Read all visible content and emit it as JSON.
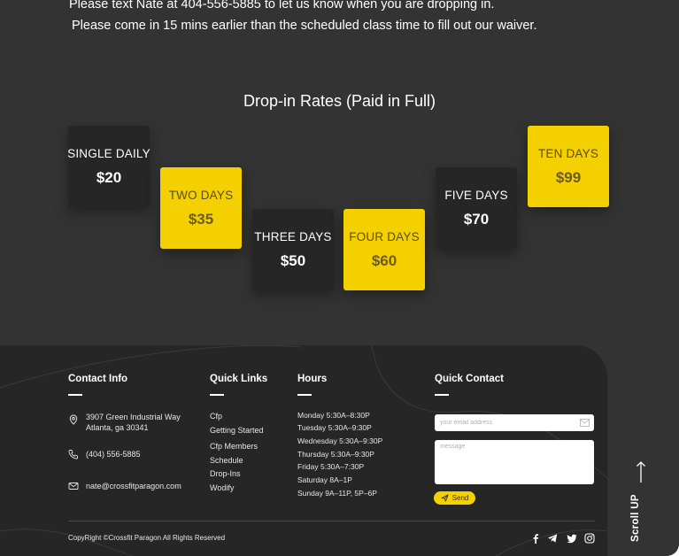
{
  "notice": {
    "line1": "Please text Nate at 404-556-5885 to let us know when you are dropping in.",
    "line2": "Please come in 15 mins earlier than the scheduled class time to fill out our waiver."
  },
  "rates": {
    "title": "Drop-in Rates (Paid in Full)",
    "cards": [
      {
        "name": "SINGLE DAILY",
        "price": "$20",
        "style": "dark"
      },
      {
        "name": "TWO DAYS",
        "price": "$35",
        "style": "yellow"
      },
      {
        "name": "THREE DAYS",
        "price": "$50",
        "style": "dark"
      },
      {
        "name": "FOUR DAYS",
        "price": "$60",
        "style": "yellow"
      },
      {
        "name": "FIVE DAYS",
        "price": "$70",
        "style": "dark"
      },
      {
        "name": "TEN DAYS",
        "price": "$99",
        "style": "yellow"
      }
    ]
  },
  "footer": {
    "contact": {
      "heading": "Contact Info",
      "address_line1": "3907 Green Industrial Way",
      "address_line2": "Atlanta, ga 30341",
      "phone": "(404) 556-5885",
      "email": "nate@crossfitparagon.com"
    },
    "quick_links": {
      "heading": "Quick Links",
      "items": [
        "Cfp",
        "Getting Started",
        "Cfp Members",
        "Schedule",
        "Drop-Ins",
        "Wodify"
      ]
    },
    "hours": {
      "heading": "Hours",
      "items": [
        "Monday  5:30A–8:30P",
        "Tuesday  5:30A–9:30P",
        "Wednesday 5:30A–9:30P",
        "Thursday  5:30A–9:30P",
        "Friday  5:30A–7:30P",
        "Saturday  8A–1P",
        "Sunday  9A–11P, 5P–6P"
      ]
    },
    "quick_contact": {
      "heading": "Quick Contact",
      "email_placeholder": "your email address",
      "message_placeholder": "message",
      "send_label": "Send"
    },
    "copyright": "CopyRight ©Crossfit Paragon  All Rights Reserved",
    "social": [
      "facebook-icon",
      "telegram-icon",
      "twitter-icon",
      "instagram-icon"
    ]
  },
  "scroll_up": {
    "label": "Scroll UP"
  },
  "colors": {
    "background": "#333333",
    "card_dark": "#262626",
    "accent_yellow": "#f5d000",
    "footer": "#262626"
  }
}
